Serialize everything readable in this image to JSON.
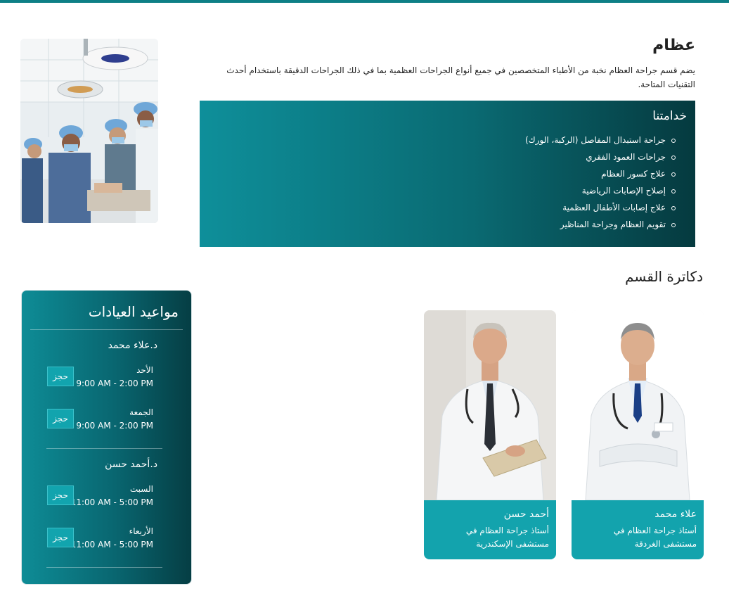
{
  "department": {
    "title": "عظام",
    "description": "يضم قسم جراحة العظام نخبة من الأطباء المتخصصين في جميع أنواع الجراحات العظمية بما في ذلك الجراحات الدقيقة باستخدام أحدث التقنيات المتاحة."
  },
  "services": {
    "title": "خدامتنا",
    "items": [
      "جراحة استبدال المفاصل (الركبة، الورك)",
      "جراحات العمود الفقري",
      "علاج كسور العظام",
      "إصلاح الإصابات الرياضية",
      "علاج إصابات الأطفال العظمية",
      "تقويم العظام وجراحة المناظير"
    ]
  },
  "doctors": {
    "title": "دكاترة القسم",
    "cards": [
      {
        "name": "علاء محمد",
        "role": "أستاذ جراحة العظام في مستشفى الغردقة"
      },
      {
        "name": "أحمد حسن",
        "role": "أستاذ جراحة العظام في مستشفى الإسكندرية"
      }
    ]
  },
  "schedule": {
    "title": "مواعيد العيادات",
    "book_label": "حجز",
    "doctors": [
      {
        "name": "د.علاء محمد",
        "slots": [
          {
            "day": "الأحد",
            "time": "9:00 AM - 2:00 PM"
          },
          {
            "day": "الجمعة",
            "time": "9:00 AM - 2:00 PM"
          }
        ]
      },
      {
        "name": "د.أحمد حسن",
        "slots": [
          {
            "day": "السبت",
            "time": "11:00 AM - 5:00 PM"
          },
          {
            "day": "الأربعاء",
            "time": "11:00 AM - 5:00 PM"
          }
        ]
      }
    ]
  },
  "colors": {
    "accent": "#13a3ad",
    "dark_teal": "#053a3f",
    "top_bar": "#0e7f86"
  }
}
